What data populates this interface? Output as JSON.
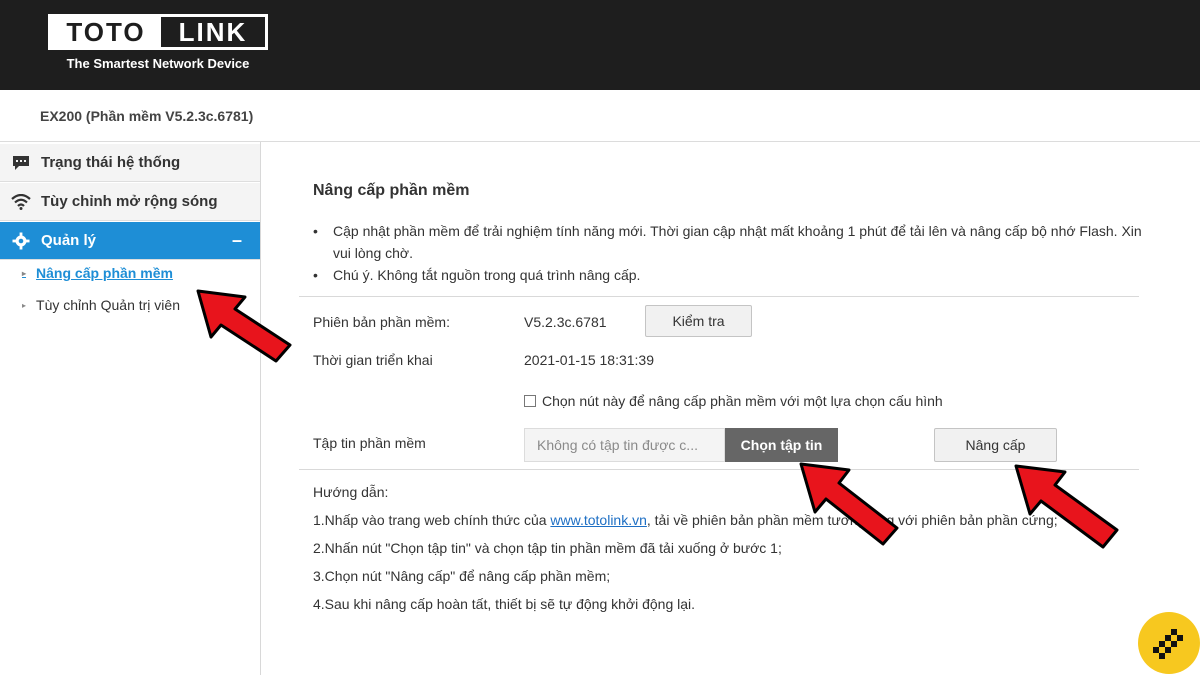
{
  "header": {
    "logo_left": "TOTO",
    "logo_right": "LINK",
    "tagline": "The Smartest Network Device",
    "model": "EX200 (Phần mềm V5.2.3c.6781)"
  },
  "sidebar": {
    "items": [
      {
        "label": "Trạng thái hệ thống",
        "icon": "chat-icon"
      },
      {
        "label": "Tùy chỉnh mở rộng sóng",
        "icon": "wifi-icon"
      },
      {
        "label": "Quản lý",
        "icon": "gear-icon",
        "toggle": "–"
      }
    ],
    "subitems": [
      {
        "label": "Nâng cấp phần mềm",
        "active": true
      },
      {
        "label": "Tùy chỉnh Quản trị viên",
        "active": false
      }
    ]
  },
  "main": {
    "title": "Nâng cấp phần mềm",
    "bullets": [
      "Cập nhật phần mềm để trải nghiệm tính năng mới. Thời gian cập nhật mất khoảng 1 phút để tải lên và nâng cấp bộ nhớ Flash. Xin vui lòng chờ.",
      "Chú ý. Không tắt nguồn trong quá trình nâng cấp."
    ],
    "version_label": "Phiên bản phần mềm:",
    "version_value": "V5.2.3c.6781",
    "check_button": "Kiểm tra",
    "deploy_label": "Thời gian triển khai",
    "deploy_value": "2021-01-15 18:31:39",
    "checkbox_label": "Chọn nút này để nâng cấp phần mềm với một lựa chọn cấu hình",
    "file_label": "Tập tin phần mềm",
    "file_placeholder": "Không có tập tin được c...",
    "choose_file_button": "Chọn tập tin",
    "upgrade_button": "Nâng cấp",
    "guide_title": "Hướng dẫn:",
    "guide_1_pre": "1.Nhấp vào trang web chính thức của ",
    "guide_1_link": "www.totolink.vn",
    "guide_1_post": ", tải về phiên bản phần mềm tương ứng với phiên bản phần cứng;",
    "guide_2": "2.Nhấn nút \"Chọn tập tin\" và chọn tập tin phần mềm đã tải xuống ở bước 1;",
    "guide_3": "3.Chọn nút \"Nâng cấp\" để nâng cấp phần mềm;",
    "guide_4": "4.Sau khi nâng cấp hoàn tất, thiết bị sẽ tự động khởi động lại."
  },
  "colors": {
    "topbar": "#1e1e1e",
    "accent": "#1e8ed6",
    "arrow": "#e8141c",
    "badge": "#f7c81f"
  }
}
